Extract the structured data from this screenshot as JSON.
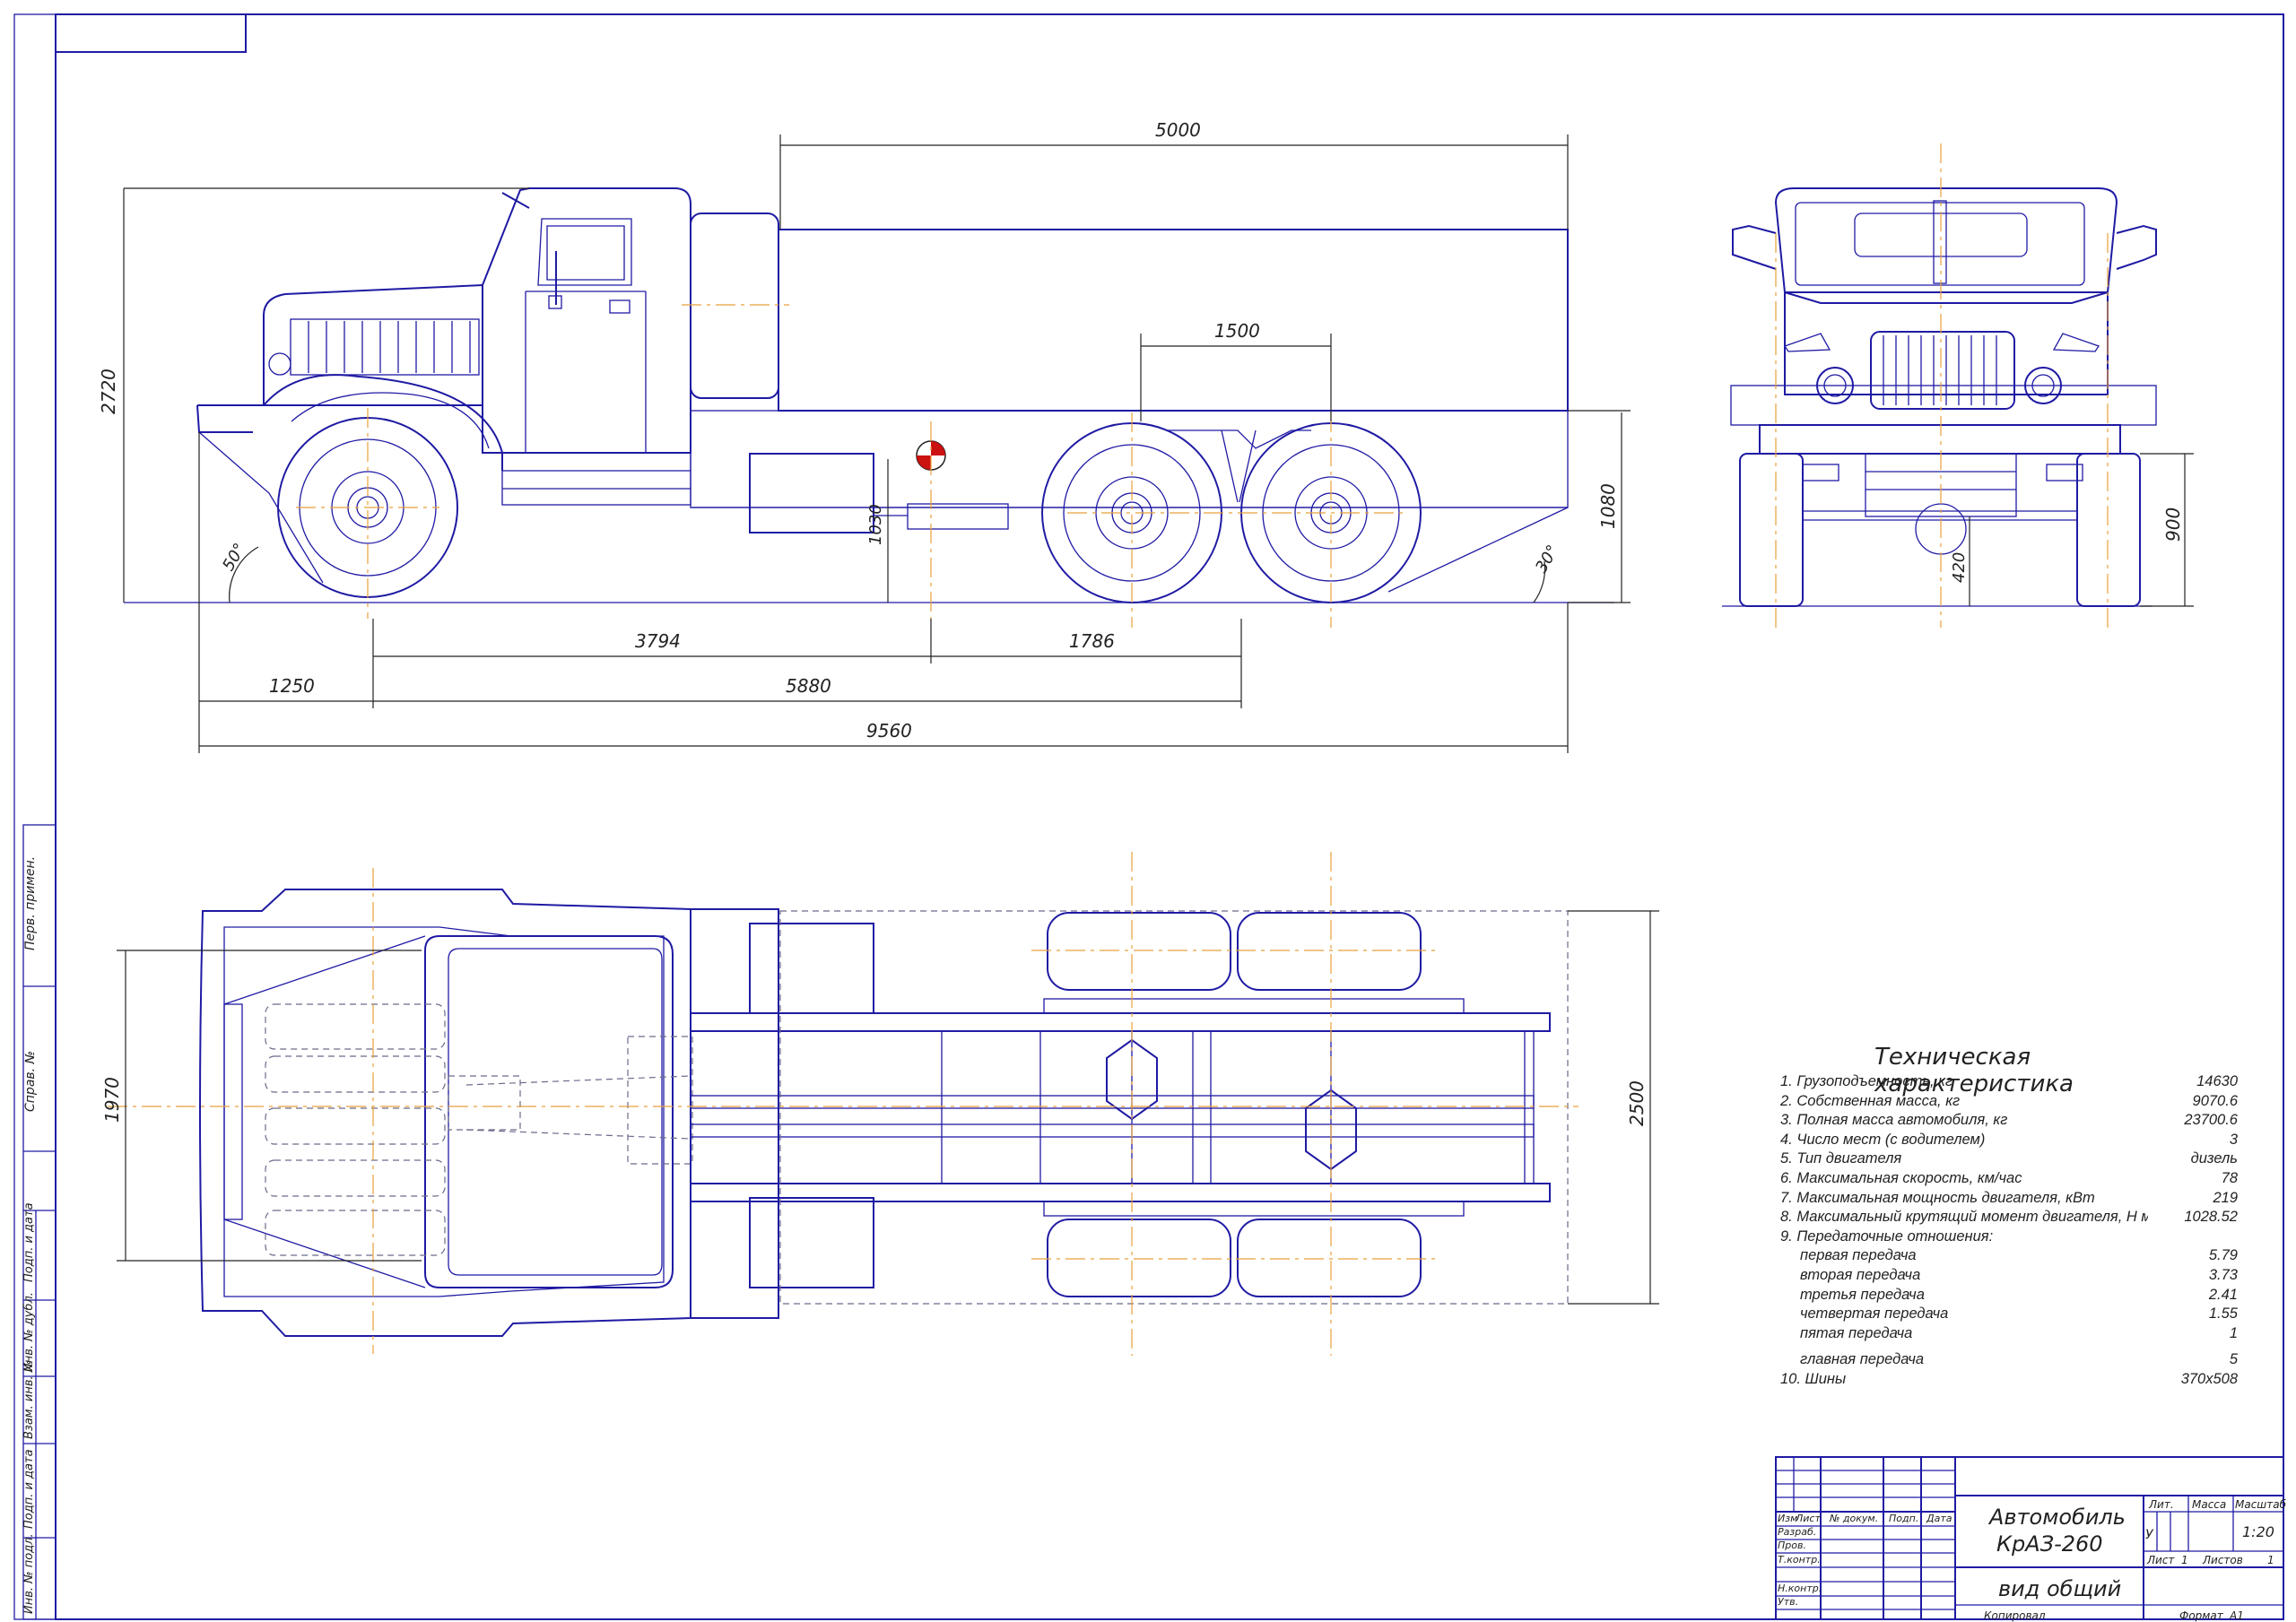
{
  "dimensions": {
    "d5000": "5000",
    "d1500": "1500",
    "d2720": "2720",
    "d1080": "1080",
    "d1030": "1030",
    "d50": "50°",
    "d30": "30°",
    "d3794": "3794",
    "d1786": "1786",
    "d1250": "1250",
    "d5880": "5880",
    "d9560": "9560",
    "d900": "900",
    "d420": "420",
    "d1970": "1970",
    "d2500": "2500"
  },
  "spec": {
    "title": "Техническая характеристика",
    "rows": [
      {
        "label": "1. Грузоподъемность, кг",
        "value": "14630"
      },
      {
        "label": "2. Собственная масса, кг",
        "value": "9070.6"
      },
      {
        "label": "3. Полная масса автомобиля, кг",
        "value": "23700.6"
      },
      {
        "label": "4. Число мест (с водителем)",
        "value": "3"
      },
      {
        "label": "5. Тип двигателя",
        "value": "дизель"
      },
      {
        "label": "6. Максимальная скорость, км/час",
        "value": "78"
      },
      {
        "label": "7. Максимальная мощность двигателя, кВт",
        "value": "219"
      },
      {
        "label": "8. Максимальный крутящий момент двигателя, Н м",
        "value": "1028.52"
      },
      {
        "label": "9. Передаточные отношения:",
        "value": ""
      }
    ],
    "gears": [
      {
        "label": "первая передача",
        "value": "5.79"
      },
      {
        "label": "вторая передача",
        "value": "3.73"
      },
      {
        "label": "третья передача",
        "value": "2.41"
      },
      {
        "label": "четвертая передача",
        "value": "1.55"
      },
      {
        "label": "пятая передача",
        "value": "1"
      }
    ],
    "main_gear": {
      "label": "главная передача",
      "value": "5"
    },
    "tires": {
      "label": "10. Шины",
      "value": "370x508"
    }
  },
  "title_block": {
    "name_line1": "Автомобиль",
    "name_line2": "КрАЗ-260",
    "view": "вид общий",
    "col_izm": "Изм",
    "col_list": "Лист",
    "col_doc": "№ докум.",
    "col_sign": "Подп.",
    "col_date": "Дата",
    "row_razrab": "Разраб.",
    "row_prov": "Пров.",
    "row_tkontr": "Т.контр.",
    "row_nkontr": "Н.контр.",
    "row_utv": "Утв.",
    "lit": "Лит.",
    "massa": "Масса",
    "masshtab": "Масштаб",
    "lit_value": "У",
    "scale": "1:20",
    "sheet_label": "Лист",
    "sheet_no": "1",
    "sheets_label": "Листов",
    "sheets_no": "1",
    "copied": "Копировал",
    "format_label": "Формат",
    "format": "А1"
  },
  "side_stamps": [
    "Перв. примен.",
    "Справ. №",
    "Подп. и дата",
    "Инв. № дубл.",
    "Взам. инв. №",
    "Подп. и дата",
    "Инв. № подл."
  ]
}
